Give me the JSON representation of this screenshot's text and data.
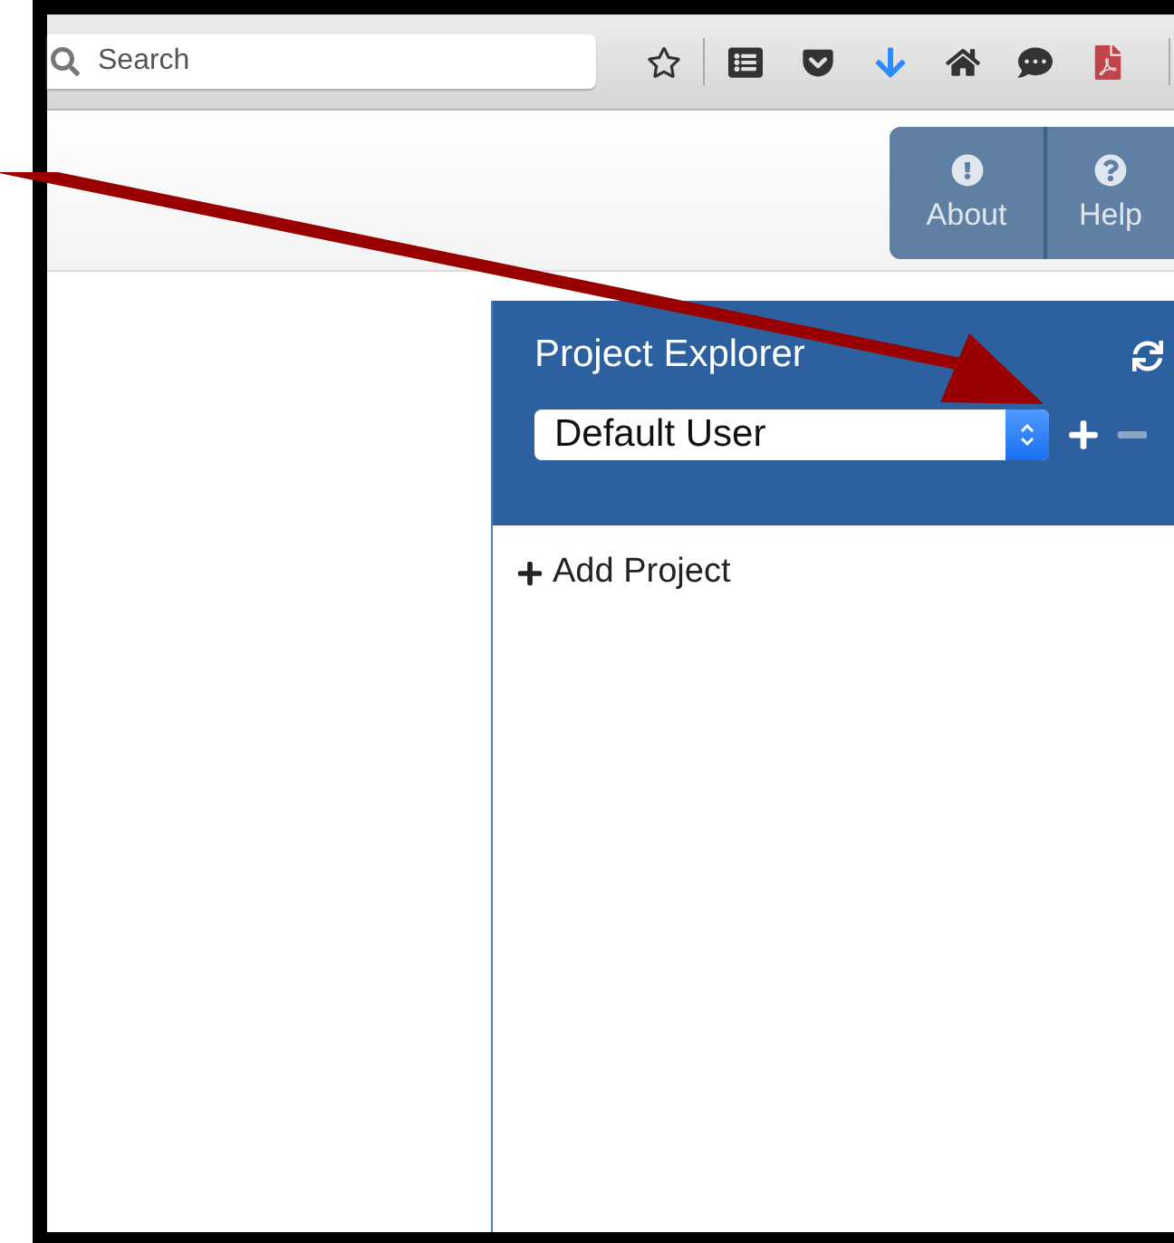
{
  "browser_toolbar": {
    "search": {
      "placeholder": "Search"
    }
  },
  "header_buttons": [
    {
      "label": "About",
      "kind": "about"
    },
    {
      "label": "Help",
      "kind": "help"
    }
  ],
  "project_explorer": {
    "title": "Project Explorer",
    "user_select": {
      "value": "Default User"
    },
    "user_buttons": [
      {
        "kind": "add",
        "disabled": false
      },
      {
        "kind": "remove",
        "disabled": true
      }
    ],
    "add_project": {
      "label": "Add Project"
    }
  }
}
